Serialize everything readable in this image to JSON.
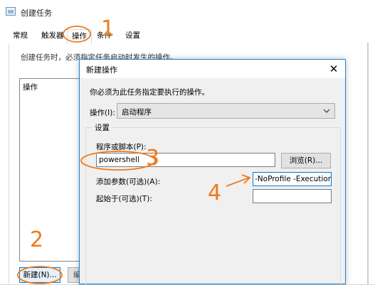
{
  "back_window": {
    "title": "创建任务",
    "tabs": [
      "常规",
      "触发器",
      "操作",
      "条件",
      "设置"
    ],
    "active_tab": "操作",
    "description": "创建任务时，必须指定任务启动时发生的操作。",
    "list_header": "操作",
    "new_button": "新建(N)...",
    "edit_button": "编"
  },
  "dialog": {
    "title": "新建操作",
    "close_icon": "close-icon",
    "instruction": "你必须为此任务指定要执行的操作。",
    "action_label": "操作(I):",
    "action_value": "启动程序",
    "settings_legend": "设置",
    "program_label": "程序或脚本(P):",
    "program_value": "powershell",
    "browse_button": "浏览(R)...",
    "args_label": "添加参数(可选)(A):",
    "args_value": "-NoProfile -ExecutionP",
    "startin_label": "起始于(可选)(T):",
    "startin_value": ""
  },
  "annotations": [
    "1",
    "2",
    "3",
    "4"
  ],
  "colors": {
    "annotation": "#f07a1a",
    "accent": "#0078d7"
  }
}
